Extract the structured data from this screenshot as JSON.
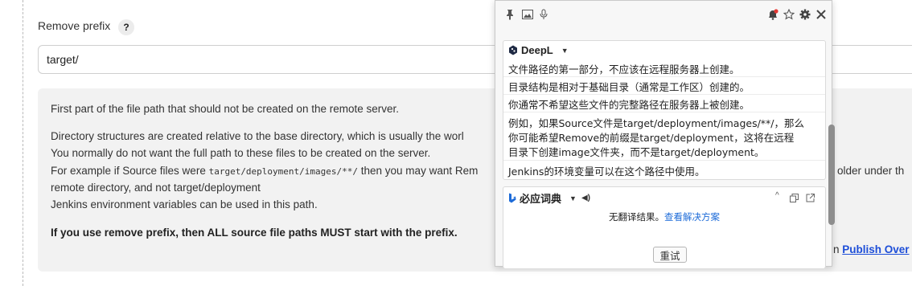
{
  "field": {
    "label": "Remove prefix",
    "help_symbol": "?",
    "value": "target/"
  },
  "help": {
    "line1": "First part of the file path that should not be created on the remote server.",
    "line2": "Directory structures are created relative to the base directory, which is usually the worl",
    "line3": "You normally do not want the full path to these files to be created on the server.",
    "line4_pre": "For example if Source files were ",
    "line4_code": "target/deployment/images/**/",
    "line4_post": " then you may want Rem",
    "line4_right": "older under th",
    "line5": "remote directory, and not target/deployment",
    "line6": "Jenkins environment variables can be used in this path.",
    "bold": "If you use remove prefix, then ALL source file paths MUST start with the prefix.",
    "right_prefix": "n ",
    "right_link": "Publish Over"
  },
  "popup": {
    "deepl": {
      "title": "DeepL",
      "lines": [
        "文件路径的第一部分，不应该在远程服务器上创建。",
        "目录结构是相对于基础目录（通常是工作区）创建的。",
        "你通常不希望这些文件的完整路径在服务器上被创建。",
        "例如，如果Source文件是target/deployment/images/**/，那么",
        "你可能希望Remove的前缀是target/deployment，这将在远程",
        "目录下创建image文件夹，而不是target/deployment。",
        "Jenkins的环境变量可以在这个路径中使用。"
      ]
    },
    "bing": {
      "title": "必应词典",
      "no_result": "无翻译结果。",
      "solution_link": "查看解决方案",
      "retry": "重试"
    }
  },
  "colors": {
    "link": "#1d4ed8",
    "bing_blue": "#1d6bd8",
    "notification_dot": "#e53935"
  }
}
